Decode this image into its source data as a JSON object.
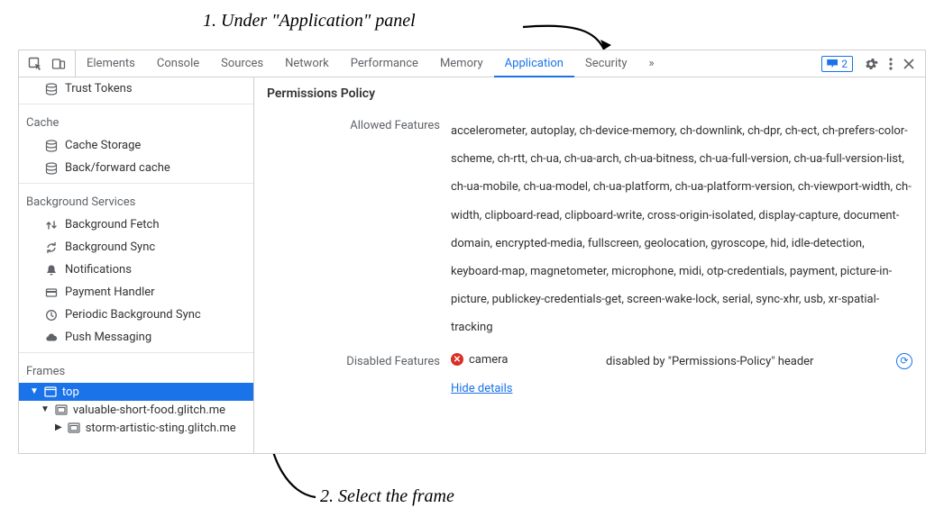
{
  "annotations": {
    "step1": "1. Under \"Application\" panel",
    "step2": "2. Select the frame"
  },
  "tabbar": {
    "tabs": [
      "Elements",
      "Console",
      "Sources",
      "Network",
      "Performance",
      "Memory",
      "Application",
      "Security"
    ],
    "active": "Application",
    "issue_count": "2"
  },
  "sidebar": {
    "groups": [
      {
        "label": "",
        "items": [
          {
            "icon": "database",
            "text": "Trust Tokens"
          }
        ]
      },
      {
        "label": "Cache",
        "items": [
          {
            "icon": "database",
            "text": "Cache Storage"
          },
          {
            "icon": "database",
            "text": "Back/forward cache"
          }
        ]
      },
      {
        "label": "Background Services",
        "items": [
          {
            "icon": "updown",
            "text": "Background Fetch"
          },
          {
            "icon": "sync",
            "text": "Background Sync"
          },
          {
            "icon": "bell",
            "text": "Notifications"
          },
          {
            "icon": "card",
            "text": "Payment Handler"
          },
          {
            "icon": "clock",
            "text": "Periodic Background Sync"
          },
          {
            "icon": "cloud",
            "text": "Push Messaging"
          }
        ]
      }
    ],
    "frames_label": "Frames",
    "frames": {
      "top": "top",
      "child1": "valuable-short-food.glitch.me",
      "child2": "storm-artistic-sting.glitch.me"
    }
  },
  "content": {
    "title": "Permissions Policy",
    "allowed_label": "Allowed Features",
    "allowed_value": "accelerometer, autoplay, ch-device-memory, ch-downlink, ch-dpr, ch-ect, ch-prefers-color-scheme, ch-rtt, ch-ua, ch-ua-arch, ch-ua-bitness, ch-ua-full-version, ch-ua-full-version-list, ch-ua-mobile, ch-ua-model, ch-ua-platform, ch-ua-platform-version, ch-viewport-width, ch-width, clipboard-read, clipboard-write, cross-origin-isolated, display-capture, document-domain, encrypted-media, fullscreen, geolocation, gyroscope, hid, idle-detection, keyboard-map, magnetometer, microphone, midi, otp-credentials, payment, picture-in-picture, publickey-credentials-get, screen-wake-lock, serial, sync-xhr, usb, xr-spatial-tracking",
    "disabled_label": "Disabled Features",
    "disabled_feature": "camera",
    "disabled_reason": "disabled by \"Permissions-Policy\" header",
    "hide_details": "Hide details"
  }
}
